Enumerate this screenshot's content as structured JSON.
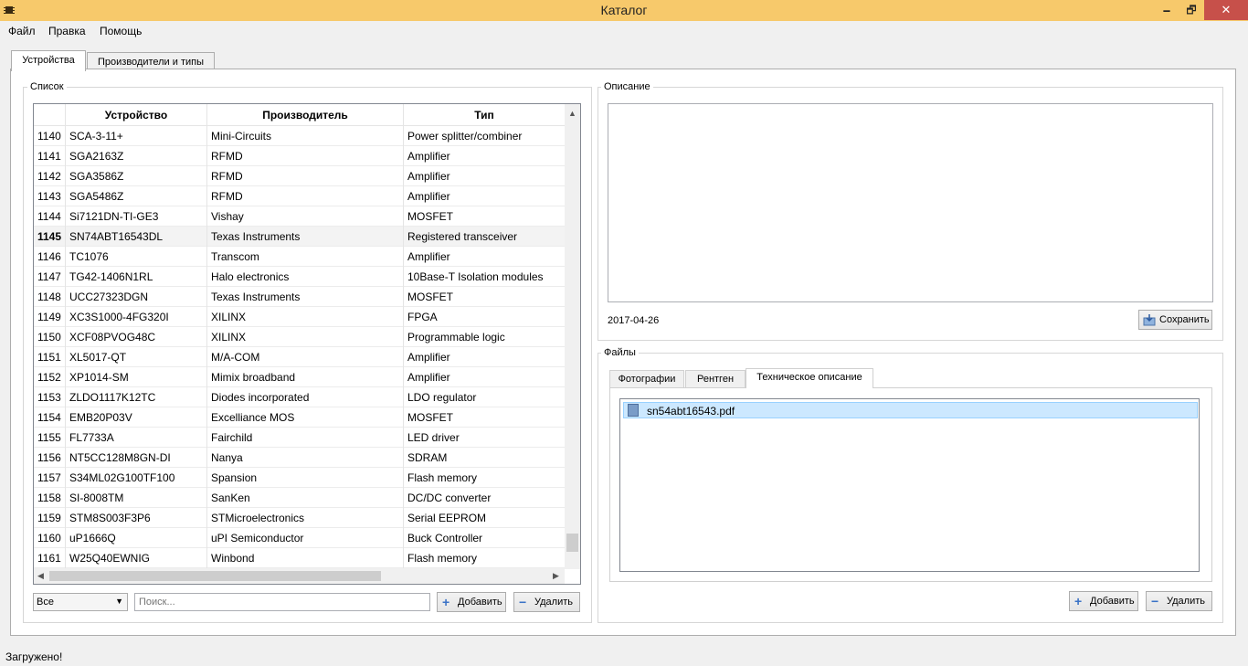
{
  "window": {
    "title": "Каталог",
    "minimize": "🗕",
    "maximize": "🗗",
    "close": "✕"
  },
  "menu": {
    "file": "Файл",
    "edit": "Правка",
    "help": "Помощь"
  },
  "tabs": {
    "devices": "Устройства",
    "manufacturers": "Производители и типы"
  },
  "list": {
    "title": "Список",
    "columns": {
      "device": "Устройство",
      "manufacturer": "Производитель",
      "type": "Тип"
    },
    "rows": [
      {
        "id": "1140",
        "device": "SCA-3-11+",
        "manufacturer": "Mini-Circuits",
        "type": "Power splitter/combiner"
      },
      {
        "id": "1141",
        "device": "SGA2163Z",
        "manufacturer": "RFMD",
        "type": "Amplifier"
      },
      {
        "id": "1142",
        "device": "SGA3586Z",
        "manufacturer": "RFMD",
        "type": "Amplifier"
      },
      {
        "id": "1143",
        "device": "SGA5486Z",
        "manufacturer": "RFMD",
        "type": "Amplifier"
      },
      {
        "id": "1144",
        "device": "Si7121DN-TI-GE3",
        "manufacturer": "Vishay",
        "type": "MOSFET"
      },
      {
        "id": "1145",
        "device": "SN74ABT16543DL",
        "manufacturer": "Texas Instruments",
        "type": "Registered transceiver"
      },
      {
        "id": "1146",
        "device": "TC1076",
        "manufacturer": "Transcom",
        "type": "Amplifier"
      },
      {
        "id": "1147",
        "device": "TG42-1406N1RL",
        "manufacturer": "Halo electronics",
        "type": "10Base-T Isolation modules"
      },
      {
        "id": "1148",
        "device": "UCC27323DGN",
        "manufacturer": "Texas Instruments",
        "type": "MOSFET"
      },
      {
        "id": "1149",
        "device": "XC3S1000-4FG320I",
        "manufacturer": "XILINX",
        "type": "FPGA"
      },
      {
        "id": "1150",
        "device": "XCF08PVOG48C",
        "manufacturer": "XILINX",
        "type": "Programmable logic"
      },
      {
        "id": "1151",
        "device": "XL5017-QT",
        "manufacturer": "M/A-COM",
        "type": "Amplifier"
      },
      {
        "id": "1152",
        "device": "XP1014-SM",
        "manufacturer": "Mimix broadband",
        "type": "Amplifier"
      },
      {
        "id": "1153",
        "device": "ZLDO1117K12TC",
        "manufacturer": "Diodes incorporated",
        "type": "LDO regulator"
      },
      {
        "id": "1154",
        "device": "EMB20P03V",
        "manufacturer": "Excelliance MOS",
        "type": "MOSFET"
      },
      {
        "id": "1155",
        "device": "FL7733A",
        "manufacturer": "Fairchild",
        "type": "LED driver"
      },
      {
        "id": "1156",
        "device": "NT5CC128M8GN-DI",
        "manufacturer": "Nanya",
        "type": "SDRAM"
      },
      {
        "id": "1157",
        "device": "S34ML02G100TF100",
        "manufacturer": "Spansion",
        "type": "Flash memory"
      },
      {
        "id": "1158",
        "device": "SI-8008TM",
        "manufacturer": "SanKen",
        "type": "DC/DC converter"
      },
      {
        "id": "1159",
        "device": "STM8S003F3P6",
        "manufacturer": "STMicroelectronics",
        "type": "Serial EEPROM"
      },
      {
        "id": "1160",
        "device": "uP1666Q",
        "manufacturer": "uPI Semiconductor",
        "type": "Buck Controller"
      },
      {
        "id": "1161",
        "device": "W25Q40EWNIG",
        "manufacturer": "Winbond",
        "type": "Flash memory"
      }
    ],
    "selected_index": 5,
    "filter_value": "Все",
    "search_placeholder": "Поиск...",
    "add_label": "Добавить",
    "remove_label": "Удалить"
  },
  "description": {
    "title": "Описание",
    "date": "2017-04-26",
    "save_label": "Сохранить"
  },
  "files": {
    "title": "Файлы",
    "tabs": {
      "photos": "Фотографии",
      "xray": "Рентген",
      "tech": "Техническое описание"
    },
    "items": [
      "sn54abt16543.pdf"
    ],
    "add_label": "Добавить",
    "remove_label": "Удалить"
  },
  "status": {
    "text": "Загружено!"
  },
  "icons": {
    "plus": "+",
    "minus": "−",
    "arrow_up": "▲",
    "arrow_left": "◀",
    "arrow_right": "▶",
    "dropdown": "▼"
  }
}
